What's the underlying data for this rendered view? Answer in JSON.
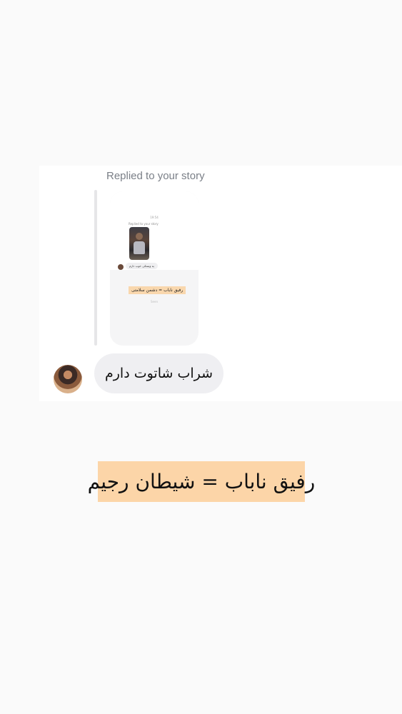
{
  "card": {
    "reply_caption": "Replied to your story",
    "story_preview": {
      "time": "19:54",
      "replied_label": "Replied to your story",
      "reply_text": "یه ویسکی خوب دارم",
      "highlight_text": "رفیق ناباب = دشمن سلامتی",
      "footer_text": "Seen"
    },
    "message_text": "شراب شاتوت دارم"
  },
  "headline_text": "رفیق ناباب = شیطان رجیم",
  "colors": {
    "background": "#fafafa",
    "card": "#ffffff",
    "bubble": "#efeff2",
    "highlight": "#fcd5a8",
    "caption": "#7a7f87"
  }
}
